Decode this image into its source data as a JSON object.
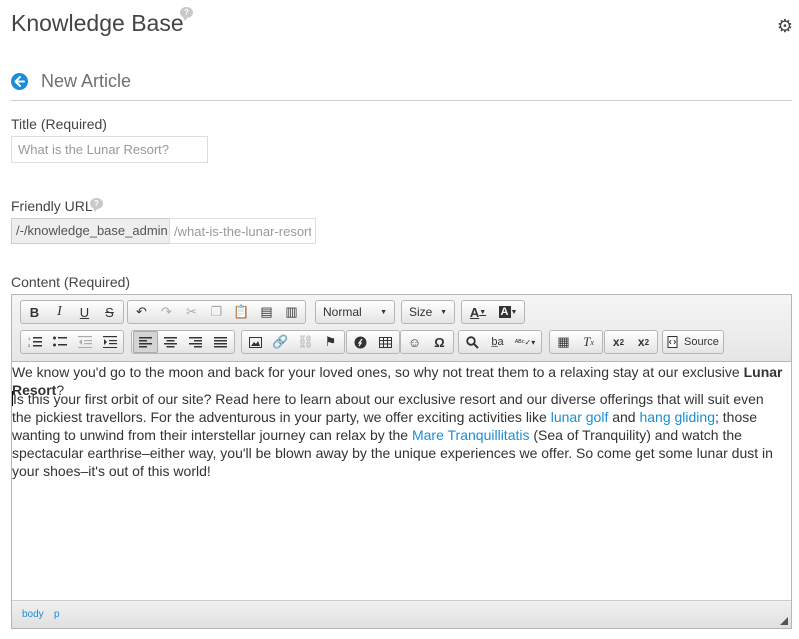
{
  "header": {
    "title": "Knowledge Base",
    "help_icon": "question-bubble-icon",
    "settings_icon": "gear-icon"
  },
  "page": {
    "back_icon": "arrow-left-circle-icon",
    "subtitle": "New Article"
  },
  "form": {
    "title_label": "Title (Required)",
    "title_placeholder": "What is the Lunar Resort?",
    "friendly_url_label": "Friendly URL",
    "friendly_url_prefix": "/-/knowledge_base_admin",
    "friendly_url_placeholder": "/what-is-the-lunar-resort",
    "content_label": "Content (Required)"
  },
  "toolbar": {
    "bold": "B",
    "italic": "I",
    "underline": "U",
    "strike": "S",
    "format_value": "Normal",
    "size_value": "Size",
    "text_color": "A",
    "bg_color": "A",
    "source_label": "Source"
  },
  "content": {
    "p1_text": "We know you'd go to the moon and back for your loved ones, so why not treat them to a relaxing stay at our exclusive ",
    "p1_bold": "Lunar Resort",
    "p1_end": "?",
    "p2_part1": "Is this your first orbit of our site? Read here to learn about our exclusive resort and our diverse offerings that will suit even the pickiest travellors. For the adventurous in your party, we offer exciting activities like ",
    "link1": "lunar golf",
    "p2_and": " and ",
    "link2": "hang gliding",
    "p2_part2": "; those wanting to unwind from their interstellar journey can relax by the ",
    "link3": "Mare Tranquillitatis",
    "p2_part3": " (Sea of Tranquility) and watch the spectacular earthrise–either way, you'll be blown away by the unique experiences we offer. So come get some lunar dust in your shoes–it's out of this world!"
  },
  "statusbar": {
    "path_body": "body",
    "path_p": "p"
  },
  "colors": {
    "accent": "#1a8ed6",
    "link": "#1a8ed6"
  }
}
